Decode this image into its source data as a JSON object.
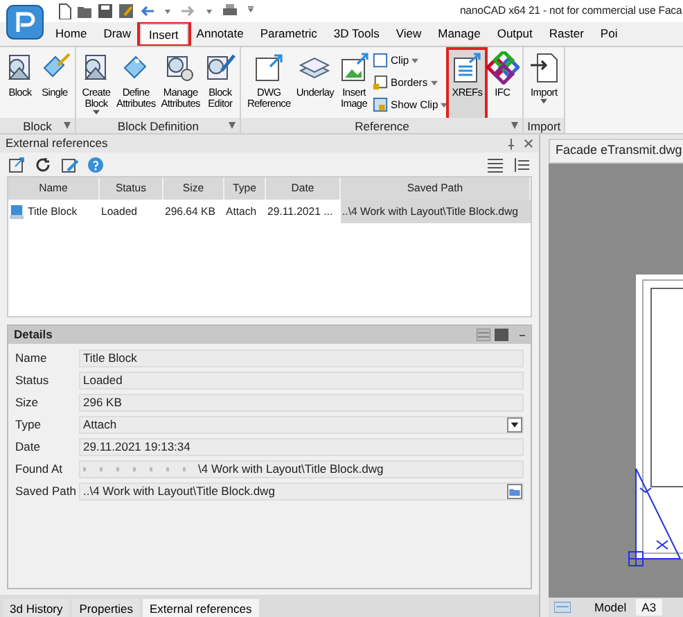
{
  "window": {
    "title": "nanoCAD x64 21 - not for commercial use Faca"
  },
  "ribbon_tabs": [
    {
      "label": "Home",
      "selected": false,
      "highlighted": false
    },
    {
      "label": "Draw",
      "selected": false,
      "highlighted": false
    },
    {
      "label": "Insert",
      "selected": true,
      "highlighted": true
    },
    {
      "label": "Annotate",
      "selected": false,
      "highlighted": false
    },
    {
      "label": "Parametric",
      "selected": false,
      "highlighted": false
    },
    {
      "label": "3D Tools",
      "selected": false,
      "highlighted": false
    },
    {
      "label": "View",
      "selected": false,
      "highlighted": false
    },
    {
      "label": "Manage",
      "selected": false,
      "highlighted": false
    },
    {
      "label": "Output",
      "selected": false,
      "highlighted": false
    },
    {
      "label": "Raster",
      "selected": false,
      "highlighted": false
    },
    {
      "label": "Poi",
      "selected": false,
      "highlighted": false
    }
  ],
  "ribbon_groups": [
    {
      "label": "Block",
      "launcher": true,
      "buttons": [
        {
          "kind": "large",
          "label": "Block",
          "dropdown": false,
          "highlighted": false
        },
        {
          "kind": "large",
          "label": "Single",
          "dropdown": false,
          "highlighted": false
        }
      ]
    },
    {
      "label": "Block Definition",
      "launcher": true,
      "buttons": [
        {
          "kind": "large",
          "label": "Create Block",
          "dropdown": true,
          "highlighted": false
        },
        {
          "kind": "large",
          "label": "Define Attributes",
          "dropdown": false,
          "highlighted": false
        },
        {
          "kind": "large",
          "label": "Manage Attributes",
          "dropdown": false,
          "highlighted": false
        },
        {
          "kind": "large",
          "label": "Block Editor",
          "dropdown": false,
          "highlighted": false
        }
      ]
    },
    {
      "label": "Reference",
      "launcher": true,
      "buttons": [
        {
          "kind": "large",
          "label": "DWG Reference",
          "dropdown": false,
          "highlighted": false
        },
        {
          "kind": "large",
          "label": "Underlay",
          "dropdown": false,
          "highlighted": false
        },
        {
          "kind": "large",
          "label": "Insert Image",
          "dropdown": false,
          "highlighted": false
        },
        {
          "kind": "small",
          "label": "Clip",
          "dropdown": true,
          "highlighted": false
        },
        {
          "kind": "small",
          "label": "Borders",
          "dropdown": true,
          "highlighted": false
        },
        {
          "kind": "small",
          "label": "Show Clip",
          "dropdown": true,
          "highlighted": false
        },
        {
          "kind": "large",
          "label": "XREFs",
          "dropdown": false,
          "highlighted": true
        },
        {
          "kind": "large",
          "label": "IFC",
          "dropdown": false,
          "highlighted": false
        }
      ]
    },
    {
      "label": "Import",
      "buttons": [
        {
          "kind": "large",
          "label": "Import",
          "dropdown": true,
          "highlighted": false
        }
      ]
    }
  ],
  "xref_panel": {
    "title": "External references",
    "table": {
      "columns": [
        "Name",
        "Status",
        "Size",
        "Type",
        "Date",
        "Saved Path"
      ],
      "rows": [
        {
          "selected": true,
          "cells": [
            "Title Block",
            "Loaded",
            "296.64 KB",
            "Attach",
            "29.11.2021 ...",
            "..\\4 Work with Layout\\Title Block.dwg"
          ]
        }
      ]
    },
    "details": {
      "title": "Details",
      "fields": [
        {
          "kind": "text",
          "label": "Name",
          "value": "Title Block"
        },
        {
          "kind": "text",
          "label": "Status",
          "value": "Loaded"
        },
        {
          "kind": "text",
          "label": "Size",
          "value": "296 KB"
        },
        {
          "kind": "select",
          "label": "Type",
          "value": "Attach"
        },
        {
          "kind": "text",
          "label": "Date",
          "value": "29.11.2021 19:13:34"
        },
        {
          "kind": "blurred",
          "label": "Found At",
          "value": "\\4 Work with Layout\\Title Block.dwg"
        },
        {
          "kind": "browse",
          "label": "Saved Path",
          "value": "..\\4 Work with Layout\\Title Block.dwg"
        }
      ]
    }
  },
  "panel_tabs": [
    {
      "label": "3d History",
      "selected": false
    },
    {
      "label": "Properties",
      "selected": false
    },
    {
      "label": "External references",
      "selected": true
    }
  ],
  "drawing": {
    "tab": "Facade eTransmit.dwg",
    "layout_tabs": [
      {
        "label": "Model",
        "selected": false
      },
      {
        "label": "A3",
        "selected": true
      }
    ]
  }
}
